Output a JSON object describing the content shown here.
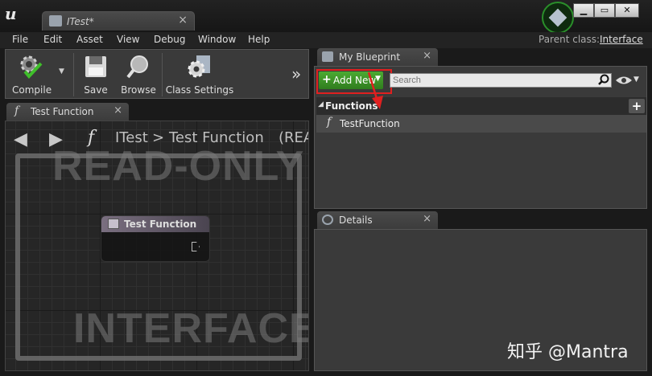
{
  "window": {
    "tab_title": "ITest*",
    "close_glyph": "×",
    "minimize_glyph": "▁",
    "maximize_glyph": "▭",
    "close_window_glyph": "✕"
  },
  "menu": [
    "File",
    "Edit",
    "Asset",
    "View",
    "Debug",
    "Window",
    "Help"
  ],
  "parent_class": {
    "label": "Parent class:",
    "value": "Interface"
  },
  "toolbar": {
    "compile": "Compile",
    "save": "Save",
    "browse": "Browse",
    "class_settings": "Class Settings",
    "more_glyph": "»"
  },
  "graph": {
    "tab_label": "Test Function",
    "breadcrumb_root": "ITest",
    "breadcrumb_sep": ">",
    "breadcrumb_current": "Test Function",
    "breadcrumb_suffix": "(REA",
    "watermark_top": "READ-ONLY",
    "watermark_bottom": "INTERFACE",
    "node_title": "Test Function"
  },
  "my_blueprint": {
    "tab_label": "My Blueprint",
    "add_new": "Add New",
    "search_placeholder": "Search",
    "section_title": "Functions",
    "functions": [
      "TestFunction"
    ]
  },
  "details": {
    "tab_label": "Details"
  },
  "watermark": "知乎 @Mantra",
  "colors": {
    "add_new_green": "#3f9a28",
    "highlight_red": "#e02020",
    "node_header": "#7a6f80"
  }
}
